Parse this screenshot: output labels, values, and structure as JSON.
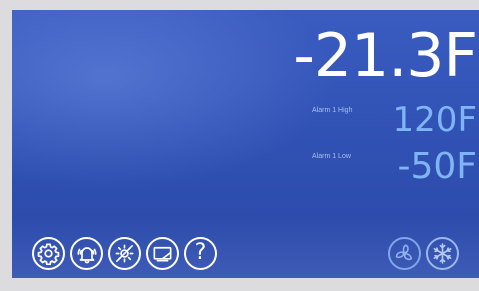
{
  "display": {
    "current_temperature": "-21.3F"
  },
  "alarms": {
    "high": {
      "label": "Alarm 1 High",
      "value": "120F"
    },
    "low": {
      "label": "Alarm 1 Low",
      "value": "-50F"
    }
  },
  "toolbar": {
    "left_buttons": [
      {
        "icon": "gear-icon"
      },
      {
        "icon": "alarm-bell-icon"
      },
      {
        "icon": "light-off-icon"
      },
      {
        "icon": "display-screen-icon"
      },
      {
        "icon": "help-icon",
        "glyph": "?"
      }
    ],
    "right_buttons": [
      {
        "icon": "fan-icon"
      },
      {
        "icon": "snowflake-icon"
      }
    ]
  },
  "colors": {
    "background": "#3152b5",
    "temperature_text": "#ffffff",
    "alarm_value_text": "#7fb4f5",
    "alarm_label_text": "#a9bff0",
    "inactive_icon": "#7fa6ea"
  }
}
